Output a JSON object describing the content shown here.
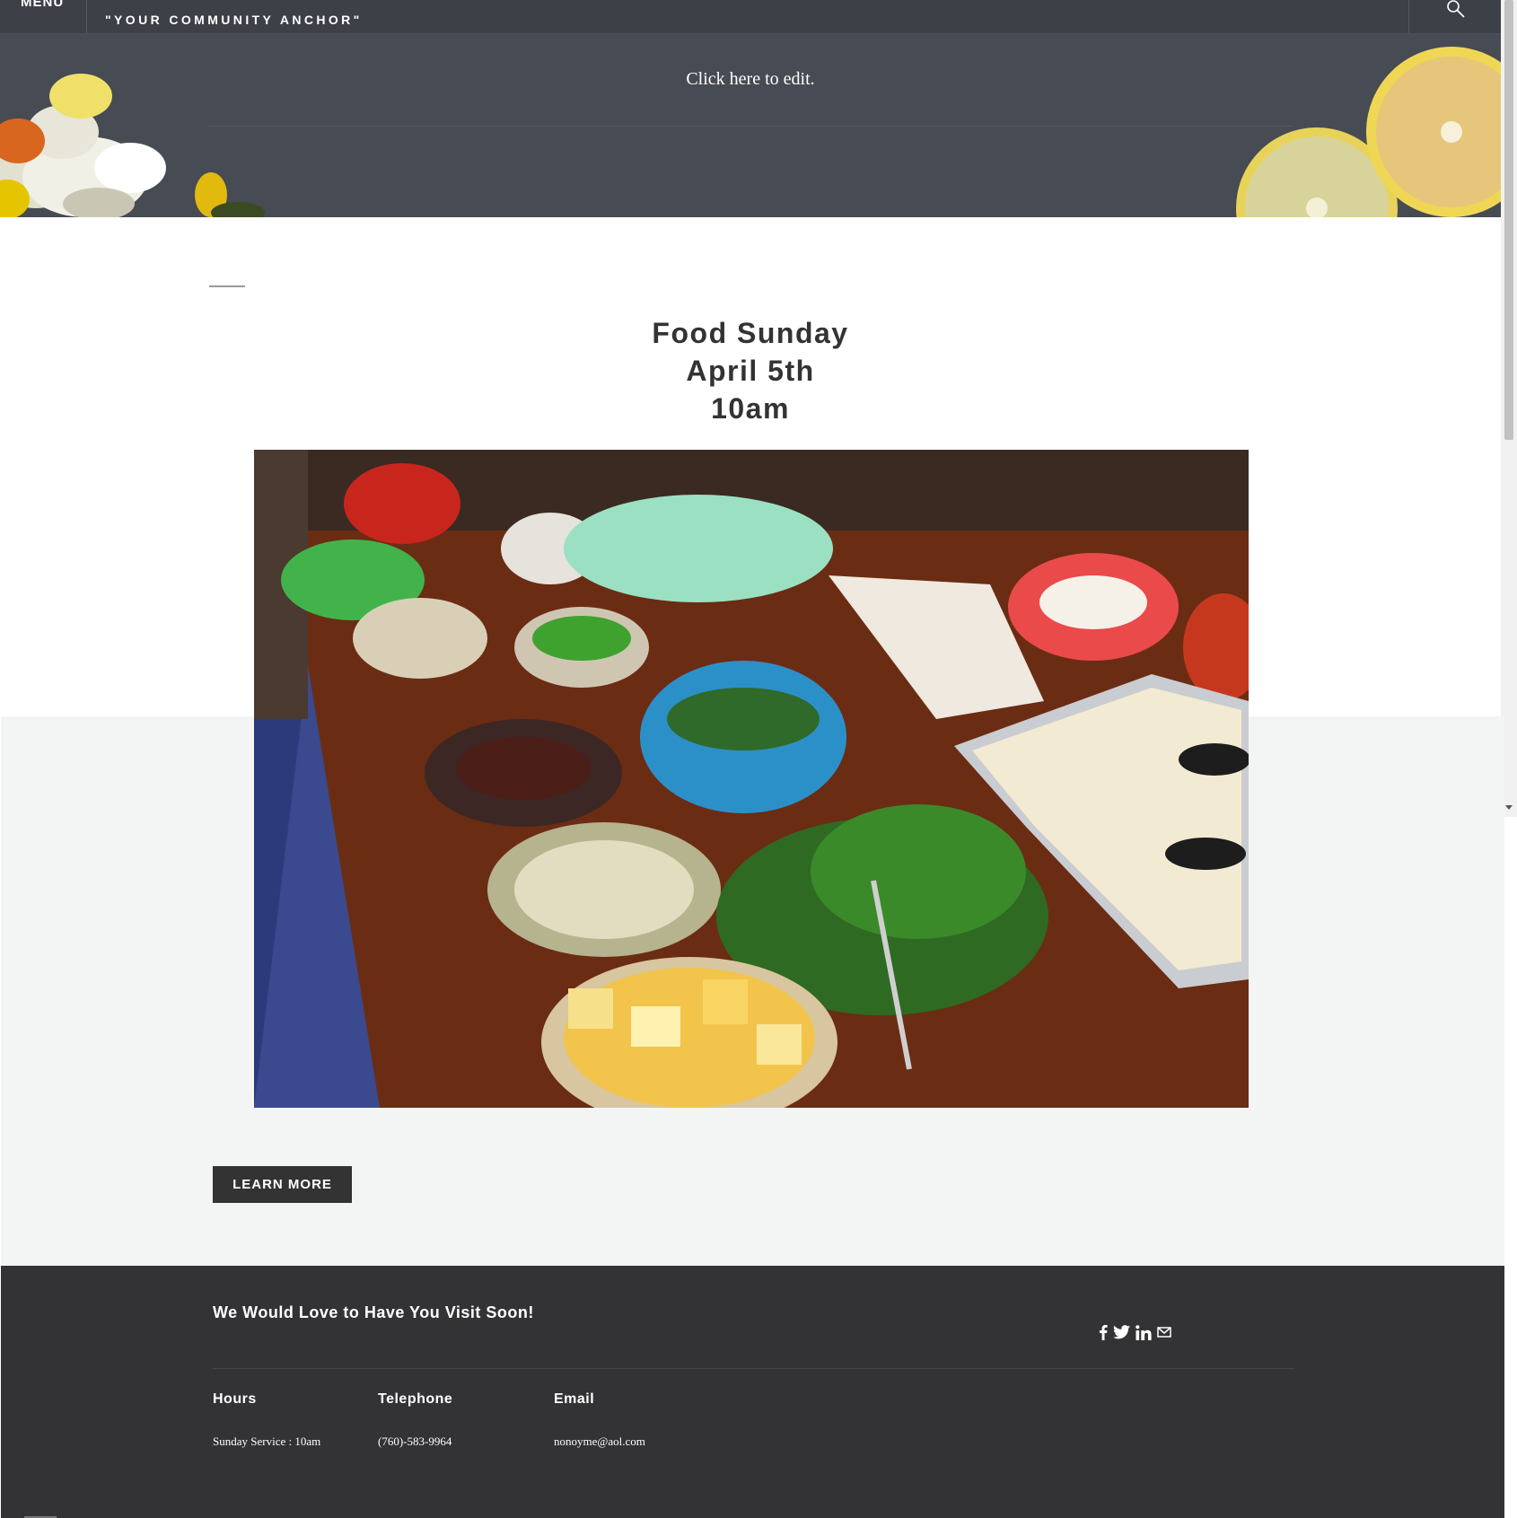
{
  "header": {
    "menu_label": "MENU",
    "tagline": "\"YOUR COMMUNITY ANCHOR\"",
    "search_icon": "search-icon"
  },
  "banner": {
    "edit_text": "Click here to edit."
  },
  "main": {
    "heading_lines": [
      "Food Sunday",
      "April 5th",
      "10am"
    ],
    "image_subject": "food-table-photo",
    "learn_more_label": "LEARN MORE"
  },
  "footer": {
    "title": "We Would Love to Have You Visit Soon!",
    "social_icons": [
      "facebook-icon",
      "twitter-icon",
      "linkedin-icon",
      "email-icon"
    ],
    "columns": [
      {
        "heading": "Hours",
        "value": "Sunday Service : 10am"
      },
      {
        "heading": "Telephone",
        "value": "(760)-583-9964"
      },
      {
        "heading": "Email",
        "value": "nonoyme@aol.com"
      }
    ]
  },
  "colors": {
    "header_bg": "#3d4047",
    "banner_bg": "#474b53",
    "section_grey": "#f3f4f4",
    "footer_bg": "#333335",
    "button_bg": "#333333",
    "text_dark": "#333333"
  }
}
